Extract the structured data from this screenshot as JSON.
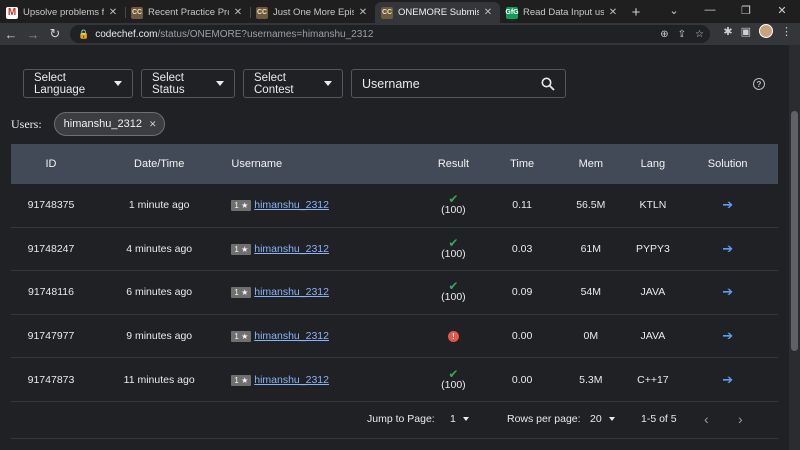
{
  "browser": {
    "tabs": [
      {
        "favicon": "M",
        "kind": "gmail",
        "title": "Upsolve problems from",
        "active": false
      },
      {
        "favicon": "CC",
        "kind": "cc",
        "title": "Recent Practice Problem",
        "active": false
      },
      {
        "favicon": "CC",
        "kind": "cc",
        "title": "Just One More Episode",
        "active": false
      },
      {
        "favicon": "CC",
        "kind": "cc",
        "title": "ONEMORE Submissions",
        "active": true
      },
      {
        "favicon": "GfG",
        "kind": "gfg",
        "title": "Read Data Input using",
        "active": false
      }
    ],
    "url_host": "codechef.com",
    "url_path": "/status/ONEMORE?usernames=himanshu_2312"
  },
  "filters": {
    "language": "Select Language",
    "status": "Select Status",
    "contest": "Select Contest",
    "username_placeholder": "Username"
  },
  "users": {
    "label": "Users:",
    "chips": [
      "himanshu_2312"
    ]
  },
  "table": {
    "headers": [
      "ID",
      "Date/Time",
      "Username",
      "Result",
      "Time",
      "Mem",
      "Lang",
      "Solution"
    ],
    "rows": [
      {
        "id": "91748375",
        "date": "1 minute ago",
        "stars": "1 ★",
        "user": "himanshu_2312",
        "status": "ok",
        "score": "(100)",
        "time": "0.11",
        "mem": "56.5M",
        "lang": "KTLN"
      },
      {
        "id": "91748247",
        "date": "4 minutes ago",
        "stars": "1 ★",
        "user": "himanshu_2312",
        "status": "ok",
        "score": "(100)",
        "time": "0.03",
        "mem": "61M",
        "lang": "PYPY3"
      },
      {
        "id": "91748116",
        "date": "6 minutes ago",
        "stars": "1 ★",
        "user": "himanshu_2312",
        "status": "ok",
        "score": "(100)",
        "time": "0.09",
        "mem": "54M",
        "lang": "JAVA"
      },
      {
        "id": "91747977",
        "date": "9 minutes ago",
        "stars": "1 ★",
        "user": "himanshu_2312",
        "status": "error",
        "score": "",
        "time": "0.00",
        "mem": "0M",
        "lang": "JAVA"
      },
      {
        "id": "91747873",
        "date": "11 minutes ago",
        "stars": "1 ★",
        "user": "himanshu_2312",
        "status": "ok",
        "score": "(100)",
        "time": "0.00",
        "mem": "5.3M",
        "lang": "C++17"
      }
    ]
  },
  "pager": {
    "jump_label": "Jump to Page:",
    "page": "1",
    "rows_label": "Rows per page:",
    "rows_value": "20",
    "range": "1-5 of 5"
  },
  "colors": {
    "accept": "#34a853",
    "error": "#e8544a",
    "link": "#8ab4f8",
    "header_bg": "#434a57"
  }
}
